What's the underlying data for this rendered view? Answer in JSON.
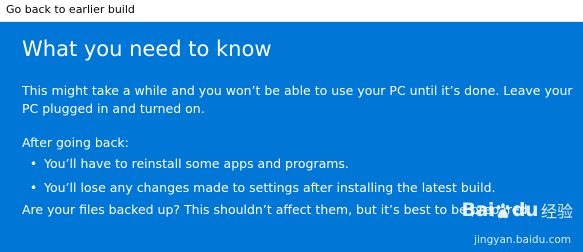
{
  "window": {
    "title": "Go back to earlier build"
  },
  "content": {
    "heading": "What you need to know",
    "paragraph": "This might take a while and you won’t be able to use your PC until it’s done. Leave your PC plugged in and turned on.",
    "after_label": "After going back:",
    "bullet_symbol": "•",
    "bullets": [
      "You’ll have to reinstall some apps and programs.",
      "You’ll lose any changes made to settings after installing the latest build."
    ],
    "question": "Are your files backed up? This shouldn’t affect them, but it’s best to be prepared."
  },
  "watermark": {
    "brand": "Bai",
    "brand_suffix": "du",
    "chinese": "经验",
    "url": "jingyan.baidu.com"
  },
  "colors": {
    "accent_blue": "#0077d6",
    "titlebar_bg": "#ffffff",
    "text_on_blue": "#ffffff"
  }
}
